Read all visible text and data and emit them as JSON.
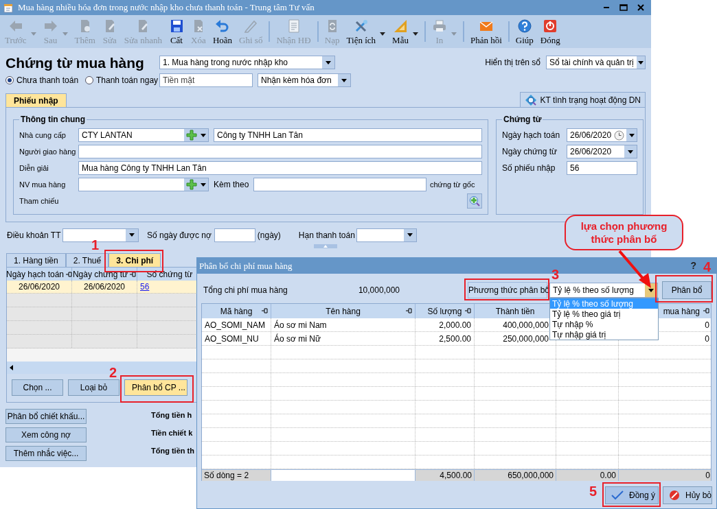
{
  "window": {
    "title": "Mua hàng nhiều hóa đơn trong nước nhập kho chưa thanh toán - Trung tâm Tư vấn"
  },
  "toolbar": {
    "groups": [
      {
        "items": [
          {
            "label": "Trước",
            "disabled": true,
            "dropdown": true
          },
          {
            "label": "Sau",
            "disabled": true,
            "dropdown": true
          },
          {
            "label": "Thêm",
            "disabled": true,
            "dropdown": false
          },
          {
            "label": "Sửa",
            "disabled": true,
            "dropdown": false
          },
          {
            "label": "Sửa nhanh",
            "disabled": true,
            "dropdown": false
          },
          {
            "label": "Cất",
            "disabled": false,
            "dropdown": false
          },
          {
            "label": "Xóa",
            "disabled": true,
            "dropdown": false
          },
          {
            "label": "Hoãn",
            "disabled": false,
            "dropdown": false
          },
          {
            "label": "Ghi sổ",
            "disabled": true,
            "dropdown": false
          }
        ]
      },
      {
        "items": [
          {
            "label": "Nhận HĐ",
            "disabled": true,
            "dropdown": false
          }
        ]
      },
      {
        "items": [
          {
            "label": "Nạp",
            "disabled": true,
            "dropdown": false
          },
          {
            "label": "Tiện ích",
            "disabled": false,
            "dropdown": true
          },
          {
            "label": "Mẫu",
            "disabled": false,
            "dropdown": true
          }
        ]
      },
      {
        "items": [
          {
            "label": "In",
            "disabled": true,
            "dropdown": true
          }
        ]
      },
      {
        "items": [
          {
            "label": "Phản hồi",
            "disabled": false,
            "dropdown": false
          }
        ]
      },
      {
        "items": [
          {
            "label": "Giúp",
            "disabled": false,
            "dropdown": false
          },
          {
            "label": "Đóng",
            "disabled": false,
            "dropdown": false
          }
        ]
      }
    ]
  },
  "header": {
    "title": "Chứng từ mua hàng",
    "voucher_type": "1. Mua hàng trong nước nhập kho",
    "ledger_label": "Hiển thị trên sổ",
    "ledger": "Sổ tài chính và quản trị",
    "payment_options": [
      {
        "label": "Chưa thanh toán",
        "selected": true
      },
      {
        "label": "Thanh toán ngay",
        "selected": false
      }
    ],
    "payment_method": {
      "value": "Tiền mặt",
      "disabled": true
    },
    "invoice_option": "Nhận kèm hóa đơn"
  },
  "form_tabs": [
    {
      "label": "Phiếu nhập",
      "selected": true
    }
  ],
  "check_button": "KT tình trạng hoạt động DN",
  "general_info": {
    "title": "Thông tin chung",
    "supplier_label": "Nhà cung cấp",
    "supplier_code": "CTY LANTAN",
    "supplier_name": "Công ty TNHH Lan Tân",
    "deliverer_label": "Người giao hàng",
    "description_label": "Diễn giải",
    "description": "Mua hàng Công ty TNHH Lan Tân",
    "buyer_label": "NV mua hàng",
    "attach_label": "Kèm theo",
    "attach_suffix": "chứng từ gốc",
    "reference_label": "Tham chiếu"
  },
  "voucher": {
    "title": "Chứng từ",
    "posting_date_label": "Ngày hạch toán",
    "posting_date": "26/06/2020",
    "voucher_date_label": "Ngày chứng từ",
    "voucher_date": "26/06/2020",
    "number_label": "Số phiếu nhập",
    "number": "56"
  },
  "terms": {
    "terms_label": "Điều khoản TT",
    "days_label": "Số ngày được nợ",
    "days_unit": "(ngày)",
    "due_label": "Hạn thanh toán"
  },
  "detail_tabs": [
    {
      "label": "1. Hàng tiền",
      "selected": false
    },
    {
      "label": "2. Thuế",
      "selected": false
    },
    {
      "label": "3. Chi phí",
      "selected": true
    }
  ],
  "cost_grid": {
    "columns": [
      "Ngày hạch toán",
      "Ngày chứng từ",
      "Số chứng từ"
    ],
    "rows": [
      [
        "26/06/2020",
        "26/06/2020",
        "56"
      ]
    ]
  },
  "cost_buttons": [
    {
      "label": "Chọn ...",
      "highlighted": false
    },
    {
      "label": "Loại bỏ",
      "highlighted": false
    },
    {
      "label": "Phân bổ CP ...",
      "highlighted": true
    }
  ],
  "side_buttons": [
    "Phân bổ chiết khấu...",
    "Xem công nợ",
    "Thêm nhắc việc..."
  ],
  "totals_labels": [
    "Tổng tiền h",
    "Tiền chiết k",
    "Tổng tiền th"
  ],
  "dialog": {
    "title": "Phân bổ chi phí mua hàng",
    "help_mark": "?",
    "total_label": "Tổng chi phí mua hàng",
    "total": "10,000,000",
    "method_label": "Phương thức phân bổ",
    "method": "Tỷ lệ % theo số lượng",
    "method_options": [
      {
        "label": "Tỷ lệ % theo số lượng",
        "selected": true
      },
      {
        "label": "Tỷ lệ % theo giá trị",
        "selected": false
      },
      {
        "label": "Tự nhập %",
        "selected": false
      },
      {
        "label": "Tự nhập giá trị",
        "selected": false
      }
    ],
    "allocate_button": "Phân bổ",
    "columns": [
      "Mã hàng",
      "Tên hàng",
      "Số lượng",
      "Thành tiền"
    ],
    "column_6": "mua hàng",
    "rows": [
      {
        "code": "AO_SOMI_NAM",
        "name": "Áo sơ mi Nam",
        "quantity": "2,000.00",
        "amount": "400,000,000",
        "column_6": "0"
      },
      {
        "code": "AO_SOMI_NU",
        "name": "Áo sơ mi Nữ",
        "quantity": "2,500.00",
        "amount": "250,000,000",
        "column_6": "0"
      }
    ],
    "footer": {
      "count": "Số dòng = 2",
      "quantity": "4,500.00",
      "amount": "650,000,000",
      "column_5": "0.00",
      "column_6": "0"
    },
    "buttons": [
      {
        "label": "Đồng ý",
        "kind": "ok"
      },
      {
        "label": "Hủy bỏ",
        "kind": "cancel"
      }
    ]
  },
  "annotations": {
    "callout": "lựa chọn phương thức phân bổ",
    "steps": [
      "1",
      "2",
      "3",
      "4",
      "5"
    ]
  }
}
